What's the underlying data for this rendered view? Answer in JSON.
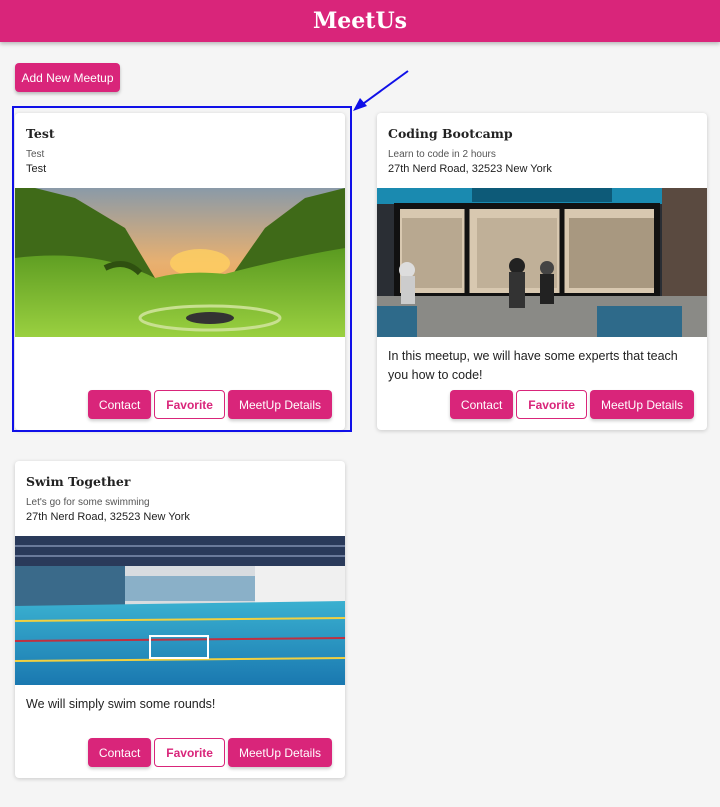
{
  "app": {
    "title": "MeetUs"
  },
  "toolbar": {
    "add_label": "Add New Meetup"
  },
  "meetups": [
    {
      "title": "Test",
      "subtitle": "Test",
      "address": "Test",
      "description": "",
      "image_icon": "landscape-image",
      "contact_label": "Contact",
      "favorite_label": "Favorite",
      "details_label": "MeetUp Details"
    },
    {
      "title": "Coding Bootcamp",
      "subtitle": "Learn to code in 2 hours",
      "address": "27th Nerd Road, 32523 New York",
      "description": "In this meetup, we will have some experts that teach you how to code!",
      "image_icon": "coffee-shop-image",
      "contact_label": "Contact",
      "favorite_label": "Favorite",
      "details_label": "MeetUp Details"
    },
    {
      "title": "Swim Together",
      "subtitle": "Let's go for some swimming",
      "address": "27th Nerd Road, 32523 New York",
      "description": "We will simply swim some rounds!",
      "image_icon": "swimming-pool-image",
      "contact_label": "Contact",
      "favorite_label": "Favorite",
      "details_label": "MeetUp Details"
    }
  ],
  "colors": {
    "brand": "#d9257a",
    "highlight": "#1010e8"
  }
}
